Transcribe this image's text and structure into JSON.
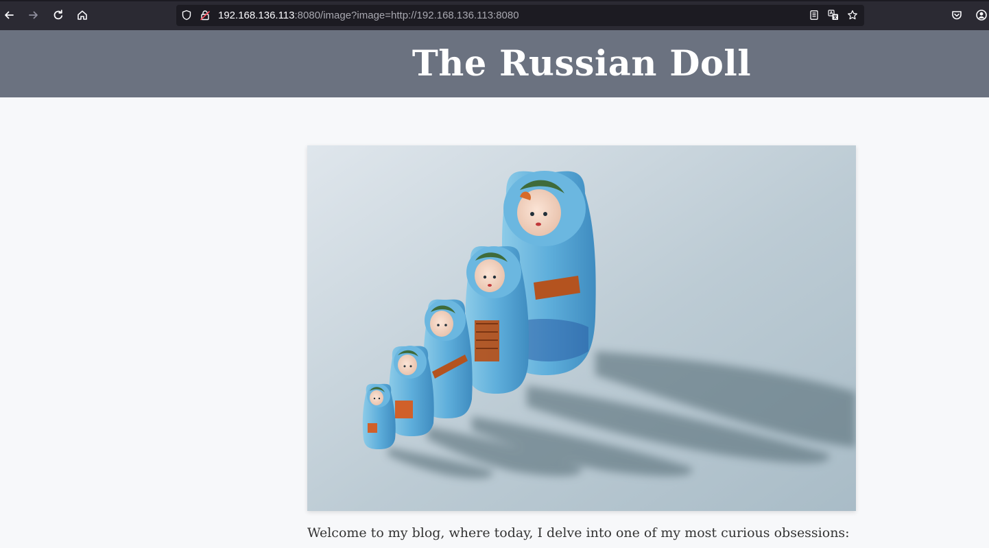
{
  "browser": {
    "url_host": "192.168.136.113",
    "url_rest": ":8080/image?image=http://192.168.136.113:8080",
    "icons": {
      "back": "arrow-left-icon",
      "forward": "arrow-right-icon",
      "reload": "reload-icon",
      "home": "home-icon",
      "tracking": "shield-icon",
      "security": "lock-warning-icon",
      "reader": "reader-view-icon",
      "translate": "translate-icon",
      "bookmark": "star-icon",
      "pocket": "pocket-icon",
      "account": "account-icon"
    }
  },
  "page": {
    "title": "The Russian Doll",
    "intro": "Welcome to my blog, where today, I delve into one of my most curious obsessions:",
    "colors": {
      "header_bg": "#6b7280",
      "page_bg": "#f7f8fa",
      "text": "#333333"
    }
  }
}
